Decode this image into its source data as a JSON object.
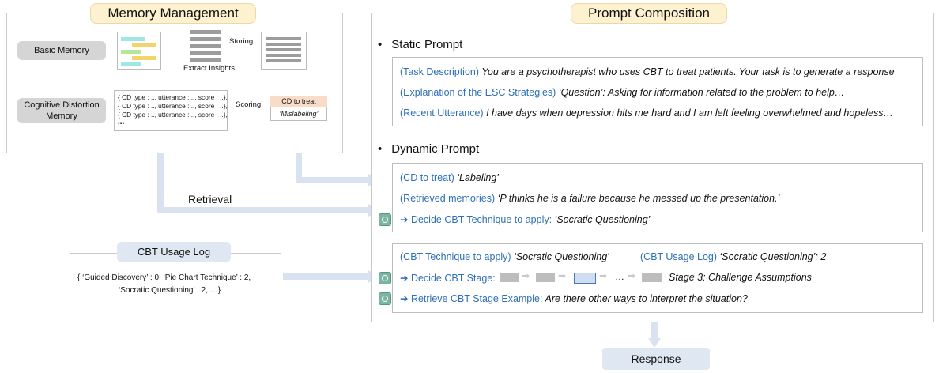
{
  "memory_management": {
    "title": "Memory Management",
    "basic_memory": "Basic Memory",
    "extract_insights": "Extract Insights",
    "storing": "Storing",
    "cd_memory": "Cognitive Distortion Memory",
    "cd_entries": [
      "{ CD type : .., utterance : .., score : ..},",
      "{ CD type : .., utterance : .., score : ..},",
      "{ CD type : .., utterance : .., score : ..},",
      "..."
    ],
    "scoring": "Scoring",
    "cd_to_treat": "CD to treat",
    "mislabeling": "‘Mislabeling’"
  },
  "retrieval_label": "Retrieval",
  "usage_log": {
    "title": "CBT Usage Log",
    "line1": "{ ‘Guided Discovery’ : 0,  ‘Pie Chart Technique’ : 2,",
    "line2": "‘Socratic Questioning’ : 2, …}"
  },
  "prompt_composition": {
    "title": "Prompt Composition",
    "static_heading": "Static Prompt",
    "static_lines": [
      {
        "label": "(Task Description)",
        "text": " You are a psychotherapist who uses CBT to treat patients. Your task is to generate a response"
      },
      {
        "label": "(Explanation of the ESC Strategies)",
        "text": " ‘Question’: Asking for information related to the problem to help…"
      },
      {
        "label": "(Recent Utterance)",
        "text": " I have days when depression hits me hard and I am left feeling overwhelmed and hopeless…"
      }
    ],
    "dynamic_heading": "Dynamic Prompt",
    "cd_label": "(CD to treat)",
    "cd_value": " ‘Labeling’",
    "retrieved_label": "(Retrieved memories)",
    "retrieved_value": " ‘P thinks he is a failure because he messed up the presentation.’",
    "decide_technique": "➔ Decide CBT Technique to apply:",
    "technique_value": " ‘Socratic Questioning’",
    "tech_label": "(CBT Technique to apply)",
    "tech_value": " ‘Socratic Questioning’",
    "log_label": "(CBT Usage Log)",
    "log_value": " ‘Socratic Questioning’: 2",
    "decide_stage": "➔ Decide CBT Stage:",
    "stage_dots": "…",
    "stage_value": "Stage 3: Challenge Assumptions",
    "retrieve_example": "➔ Retrieve CBT Stage Example:",
    "example_value": " Are there other ways to interpret the situation?"
  },
  "response_label": "Response"
}
